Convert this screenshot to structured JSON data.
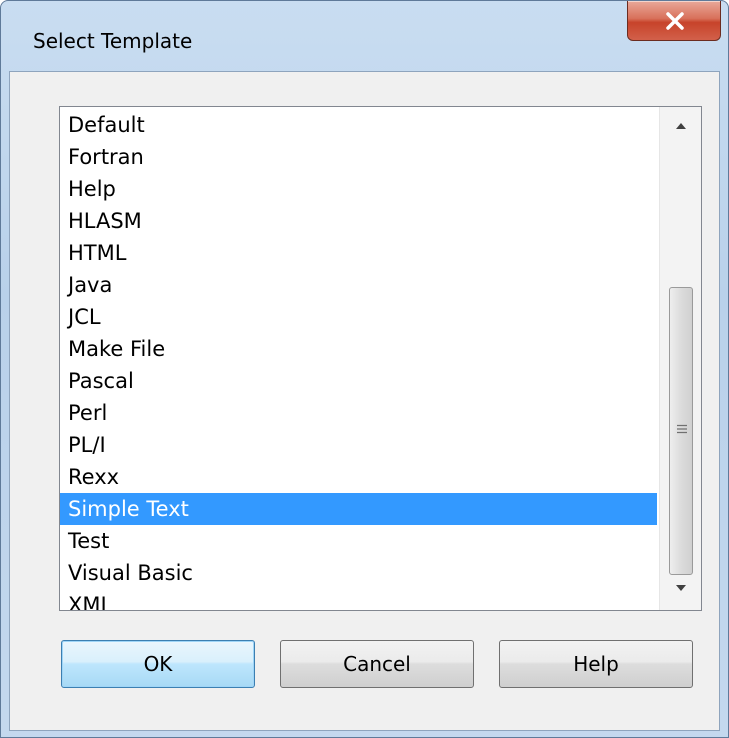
{
  "window": {
    "title": "Select Template",
    "close_label": "x"
  },
  "list": {
    "items": [
      "Default",
      "Fortran",
      "Help",
      "HLASM",
      "HTML",
      "Java",
      "JCL",
      "Make File",
      "Pascal",
      "Perl",
      "PL/I",
      "Rexx",
      "Simple Text",
      "Test",
      "Visual Basic",
      "XML"
    ],
    "selected": "Simple Text"
  },
  "buttons": {
    "ok": "OK",
    "cancel": "Cancel",
    "help": "Help"
  },
  "icons": {
    "close": "close-icon",
    "scroll_up": "scroll-up-arrow-icon",
    "scroll_down": "scroll-down-arrow-icon",
    "grip": "scroll-grip-icon"
  },
  "colors": {
    "selection": "#3399ff",
    "close_button": "#c7432a",
    "frame": "#b9d1ea"
  }
}
